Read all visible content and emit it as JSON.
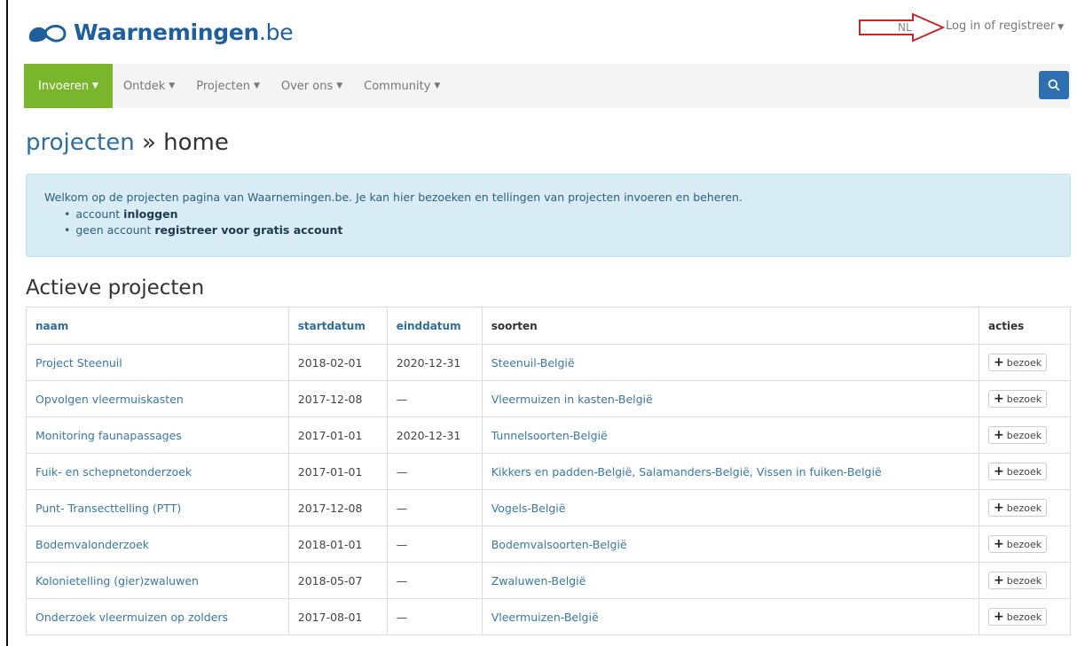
{
  "brand": {
    "name_bold": "Waarnemingen",
    "name_tld": ".be"
  },
  "topbar": {
    "language": "NL",
    "login_label": "Log in of registreer"
  },
  "nav": {
    "items": [
      {
        "label": "Invoeren"
      },
      {
        "label": "Ontdek"
      },
      {
        "label": "Projecten"
      },
      {
        "label": "Over ons"
      },
      {
        "label": "Community"
      }
    ],
    "active_color": "#7ab62b",
    "search_color": "#2e6fb1"
  },
  "title": {
    "crumb": "projecten",
    "separator": " » ",
    "page": "home"
  },
  "info": {
    "text": "Welkom op de projecten pagina van Waarnemingen.be. Je kan hier bezoeken en tellingen van projecten invoeren en beheren.",
    "item1_prefix": "account ",
    "item1_link": "inloggen",
    "item2_prefix": "geen account ",
    "item2_link": "registreer voor gratis account"
  },
  "section_title": "Actieve projecten",
  "table": {
    "headers": {
      "naam": "naam",
      "startdatum": "startdatum",
      "einddatum": "einddatum",
      "soorten": "soorten",
      "acties": "acties"
    },
    "action_label": "bezoek",
    "rows": [
      {
        "naam": "Project Steenuil",
        "start": "2018-02-01",
        "eind": "2020-12-31",
        "soorten": "Steenuil-België"
      },
      {
        "naam": "Opvolgen vleermuiskasten",
        "start": "2017-12-08",
        "eind": "—",
        "soorten": "Vleermuizen in kasten-België"
      },
      {
        "naam": "Monitoring faunapassages",
        "start": "2017-01-01",
        "eind": "2020-12-31",
        "soorten": "Tunnelsoorten-België"
      },
      {
        "naam": "Fuik- en schepnetonderzoek",
        "start": "2017-01-01",
        "eind": "—",
        "soorten": "Kikkers en padden-België, Salamanders-België, Vissen in fuiken-België"
      },
      {
        "naam": "Punt- Transecttelling (PTT)",
        "start": "2017-12-08",
        "eind": "—",
        "soorten": "Vogels-België"
      },
      {
        "naam": "Bodemvalonderzoek",
        "start": "2018-01-01",
        "eind": "—",
        "soorten": "Bodemvalsoorten-België"
      },
      {
        "naam": "Kolonietelling (gier)zwaluwen",
        "start": "2018-05-07",
        "eind": "—",
        "soorten": "Zwaluwen-België"
      },
      {
        "naam": "Onderzoek vleermuizen op zolders",
        "start": "2017-08-01",
        "eind": "—",
        "soorten": "Vleermuizen-België"
      }
    ]
  }
}
